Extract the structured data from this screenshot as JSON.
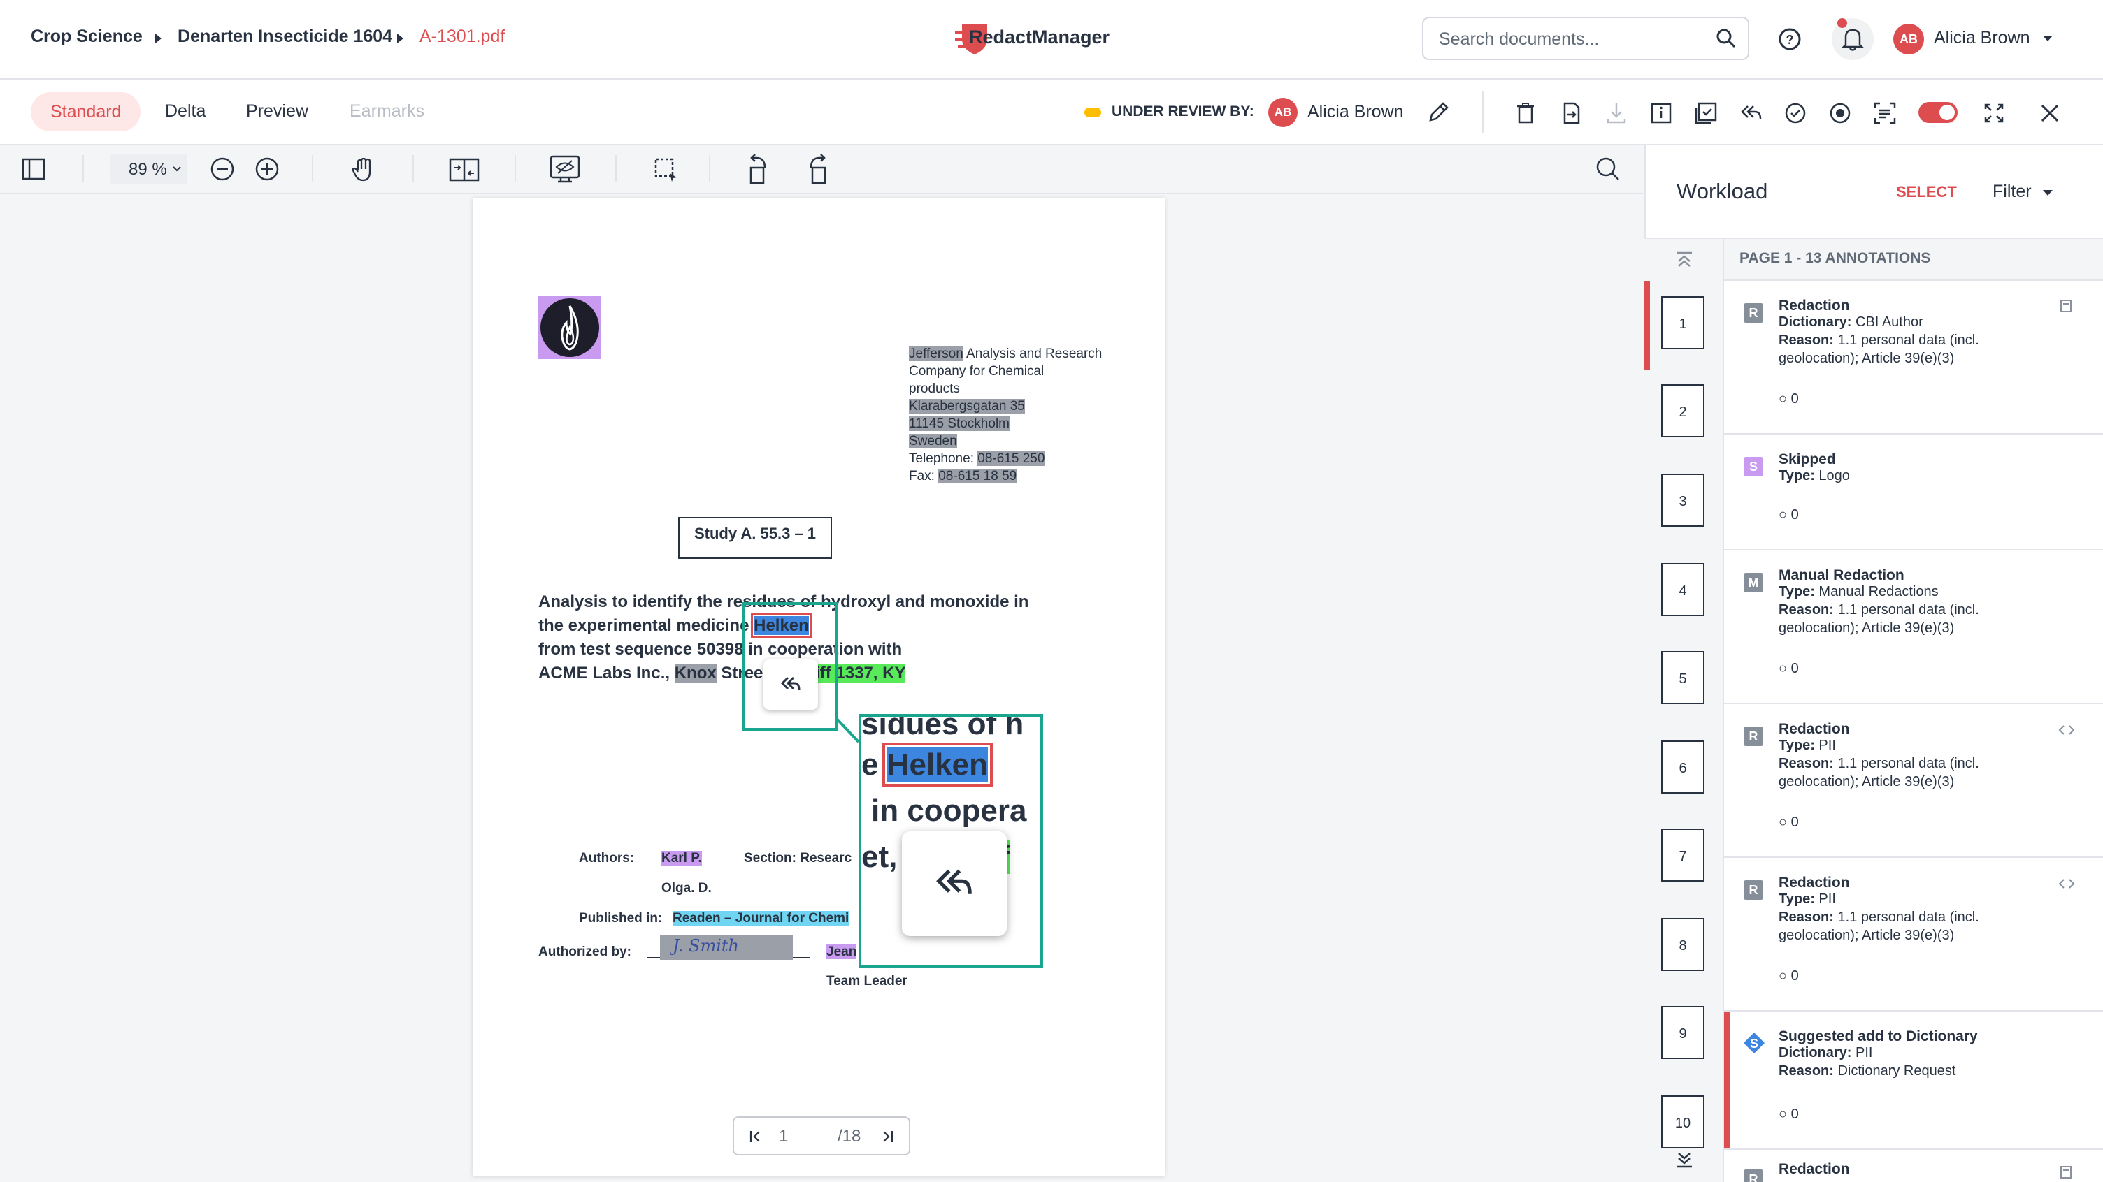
{
  "header": {
    "breadcrumbs": [
      "Crop Science",
      "Denarten Insecticide 1604",
      "A-1301.pdf"
    ],
    "app_name": "RedactManager",
    "search_placeholder": "Search documents...",
    "user_initials": "AB",
    "user_name": "Alicia Brown"
  },
  "tabs": {
    "standard": "Standard",
    "delta": "Delta",
    "preview": "Preview",
    "earmarks": "Earmarks"
  },
  "review": {
    "label": "UNDER REVIEW BY:",
    "reviewer_initials": "AB",
    "reviewer_name": "Alicia Brown",
    "status_color": "#fdbd00"
  },
  "viewer": {
    "zoom": "89 %",
    "page_current": "1",
    "page_total": "/18"
  },
  "document": {
    "address": {
      "company_name": "Jefferson",
      "company_rest_1": " Analysis and Research",
      "company_rest_2": "Company for Chemical",
      "company_rest_3": "products",
      "street": "Klarabergsgatan 35",
      "city": "11145 Stockholm",
      "country": "Sweden",
      "telephone_label": "Telephone: ",
      "telephone": "08-615 250",
      "fax_label": "Fax: ",
      "fax": "08-615 18 59"
    },
    "study_box": "Study A. 55.3 – 1",
    "title_line1": "Analysis to identify the residues of hydroxyl and monoxide in",
    "title_line2_a": "the experimental medicine ",
    "title_line2_hl": "Helken",
    "title_line3": "from test sequence 50398 in cooperation with",
    "title_line4_a": "ACME Labs Inc., ",
    "title_line4_knox": "Knox",
    "title_line4_b": " Street,",
    "title_line4_c": "iff 1337, KY",
    "authors_label": "Authors:",
    "author1": "Karl P.",
    "author2": "Olga. D.",
    "section_label": "Section: Researc",
    "published_label": "Published in:",
    "published_value": "Readen – Journal for Chemi",
    "authorized_label": "Authorized by:",
    "signature_text": "J. Smith",
    "jean": "Jean",
    "team_leader": "Team Leader",
    "zoom_line1": "sidues of h",
    "zoom_line2_a": "e ",
    "zoom_line2_hl": "Helken",
    "zoom_line3": "in coopera",
    "zoom_line4_a": "et,",
    "zoom_line4_b": "iff"
  },
  "workload": {
    "title": "Workload",
    "select": "SELECT",
    "filter": "Filter",
    "page_header": "PAGE 1 - 13 ANNOTATIONS",
    "thumbs": [
      "1",
      "2",
      "3",
      "4",
      "5",
      "6",
      "7",
      "8",
      "9",
      "10"
    ],
    "annotations": [
      {
        "badge": "R",
        "title": "Redaction",
        "l1k": "Dictionary:",
        "l1v": " CBI Author",
        "l2k": "Reason:",
        "l2v": " 1.1 personal data (incl.",
        "l3": "geolocation); Article 39(e)(3)",
        "comments": "0"
      },
      {
        "badge": "S",
        "title": "Skipped",
        "l1k": "Type:",
        "l1v": " Logo",
        "comments": "0"
      },
      {
        "badge": "M",
        "title": "Manual Redaction",
        "l1k": "Type:",
        "l1v": " Manual Redactions",
        "l2k": "Reason:",
        "l2v": " 1.1 personal data (incl.",
        "l3": "geolocation); Article 39(e)(3)",
        "comments": "0"
      },
      {
        "badge": "R",
        "title": "Redaction",
        "l1k": "Type:",
        "l1v": " PII",
        "l2k": "Reason:",
        "l2v": " 1.1 personal data (incl.",
        "l3": "geolocation); Article 39(e)(3)",
        "comments": "0"
      },
      {
        "badge": "R",
        "title": "Redaction",
        "l1k": "Type:",
        "l1v": " PII",
        "l2k": "Reason:",
        "l2v": " 1.1 personal data (incl.",
        "l3": "geolocation); Article 39(e)(3)",
        "comments": "0"
      },
      {
        "badge": "S",
        "title": "Suggested add to Dictionary",
        "l1k": "Dictionary:",
        "l1v": " PII",
        "l2k": "Reason:",
        "l2v": " Dictionary Request",
        "comments": "0"
      },
      {
        "badge": "R",
        "title": "Redaction"
      }
    ]
  },
  "colors": {
    "accent": "#dd4d50",
    "teal": "#1aa58f",
    "toggle": "#dd4d50"
  }
}
